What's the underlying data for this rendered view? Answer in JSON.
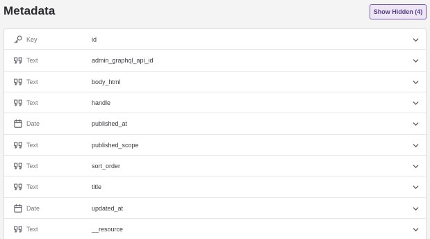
{
  "header": {
    "title": "Metadata",
    "show_hidden_label": "Show Hidden (4)"
  },
  "fields": [
    {
      "type": "Key",
      "icon": "key-icon",
      "name": "id"
    },
    {
      "type": "Text",
      "icon": "quote-icon",
      "name": "admin_graphql_api_id"
    },
    {
      "type": "Text",
      "icon": "quote-icon",
      "name": "body_html"
    },
    {
      "type": "Text",
      "icon": "quote-icon",
      "name": "handle"
    },
    {
      "type": "Date",
      "icon": "calendar-icon",
      "name": "published_at"
    },
    {
      "type": "Text",
      "icon": "quote-icon",
      "name": "published_scope"
    },
    {
      "type": "Text",
      "icon": "quote-icon",
      "name": "sort_order"
    },
    {
      "type": "Text",
      "icon": "quote-icon",
      "name": "title"
    },
    {
      "type": "Date",
      "icon": "calendar-icon",
      "name": "updated_at"
    },
    {
      "type": "Text",
      "icon": "quote-icon",
      "name": "__resource"
    }
  ],
  "colors": {
    "accent": "#7b5ea7",
    "button_bg": "#ece6f5",
    "background": "#f4f4f5"
  }
}
